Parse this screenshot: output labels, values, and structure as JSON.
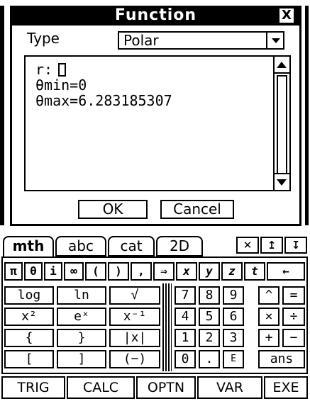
{
  "dialog": {
    "title": "Function",
    "close_label": "X",
    "type_label": "Type",
    "type_value": "Polar",
    "lines": [
      "r:",
      "θmin=0",
      "θmax=6.283185307"
    ],
    "ok_label": "OK",
    "cancel_label": "Cancel"
  },
  "keyboard": {
    "tabs": [
      "mth",
      "abc",
      "cat",
      "2D"
    ],
    "tab_icons": [
      "close-icon",
      "up-arrow-icon",
      "down-arrow-icon"
    ],
    "symbols": [
      "π",
      "θ",
      "i",
      "∞",
      "(",
      ")",
      ",",
      "⇒",
      "x",
      "y",
      "z",
      "t",
      "←"
    ],
    "functions": [
      [
        "log",
        "ln",
        "√"
      ],
      [
        "x²",
        "eˣ",
        "x⁻¹"
      ],
      [
        "{",
        "}",
        "|x|"
      ],
      [
        "[",
        "]",
        "(−)"
      ]
    ],
    "numpad": [
      [
        "7",
        "8",
        "9",
        "^",
        "="
      ],
      [
        "4",
        "5",
        "6",
        "×",
        "÷"
      ],
      [
        "1",
        "2",
        "3",
        "+",
        "−"
      ],
      [
        "0",
        ".",
        "E",
        "ans"
      ]
    ],
    "softkeys": [
      "TRIG",
      "CALC",
      "OPTN",
      "VAR",
      "EXE"
    ]
  }
}
